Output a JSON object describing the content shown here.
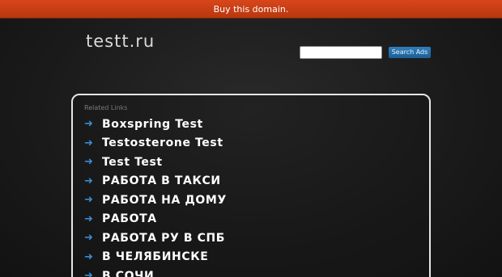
{
  "banner": {
    "text": "Buy this domain."
  },
  "site": {
    "title": "testt.ru"
  },
  "search": {
    "placeholder": "",
    "value": "",
    "button_label": "Search Ads"
  },
  "related": {
    "heading": "Related Links",
    "links": [
      "Boxspring Test",
      "Testosterone Test",
      "Test Test",
      "РАБОТА В ТАКСИ",
      "РАБОТА НА ДОМУ",
      "РАБОТА",
      "РАБОТА РУ В СПБ",
      "В ЧЕЛЯБИНСКЕ",
      "В СОЧИ"
    ]
  },
  "colors": {
    "banner": "#c8401a",
    "accent": "#3a8bd0",
    "button": "#2670ad"
  },
  "icons": {
    "link_bullet": "arrow-right-icon"
  }
}
